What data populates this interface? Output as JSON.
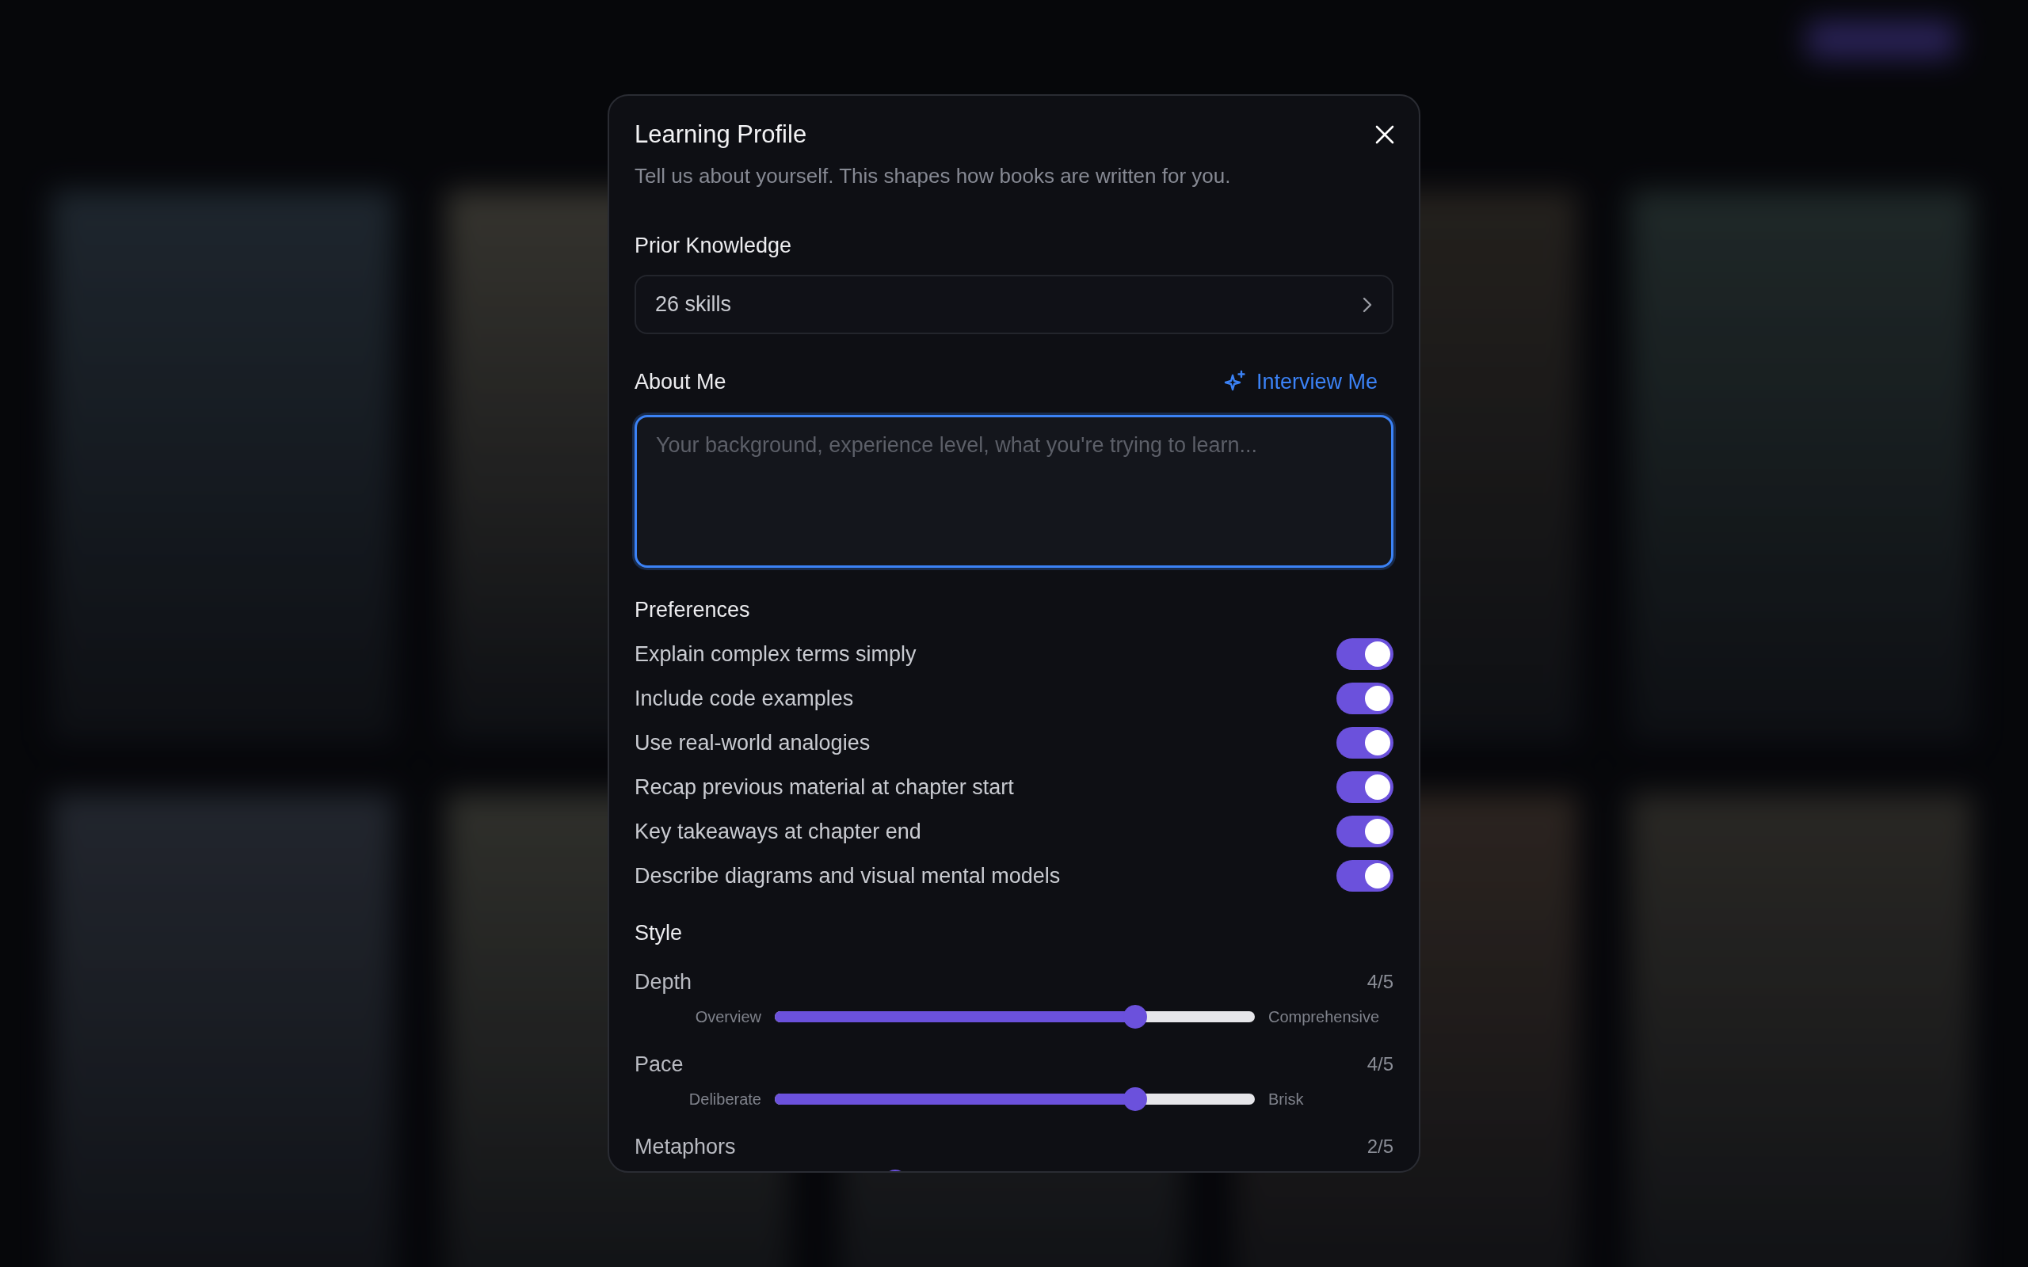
{
  "dialog": {
    "title": "Learning Profile",
    "subtitle": "Tell us about yourself. This shapes how books are written for you.",
    "prior_knowledge": {
      "label": "Prior Knowledge",
      "value": "26 skills"
    },
    "about_me": {
      "label": "About Me",
      "action": "Interview Me",
      "placeholder": "Your background, experience level, what you're trying to learn...",
      "focused": true
    },
    "preferences": {
      "heading": "Preferences",
      "items": [
        {
          "label": "Explain complex terms simply",
          "on": true
        },
        {
          "label": "Include code examples",
          "on": true
        },
        {
          "label": "Use real-world analogies",
          "on": true
        },
        {
          "label": "Recap previous material at chapter start",
          "on": true
        },
        {
          "label": "Key takeaways at chapter end",
          "on": true
        },
        {
          "label": "Describe diagrams and visual mental models",
          "on": true
        }
      ]
    },
    "style": {
      "heading": "Style",
      "sliders": [
        {
          "label": "Depth",
          "reading": "4/5",
          "level": 0.75,
          "min_label": "Overview",
          "max_label": "Comprehensive"
        },
        {
          "label": "Pace",
          "reading": "4/5",
          "level": 0.75,
          "min_label": "Deliberate",
          "max_label": "Brisk"
        },
        {
          "label": "Metaphors",
          "reading": "2/5",
          "level": 0.25
        }
      ]
    }
  }
}
